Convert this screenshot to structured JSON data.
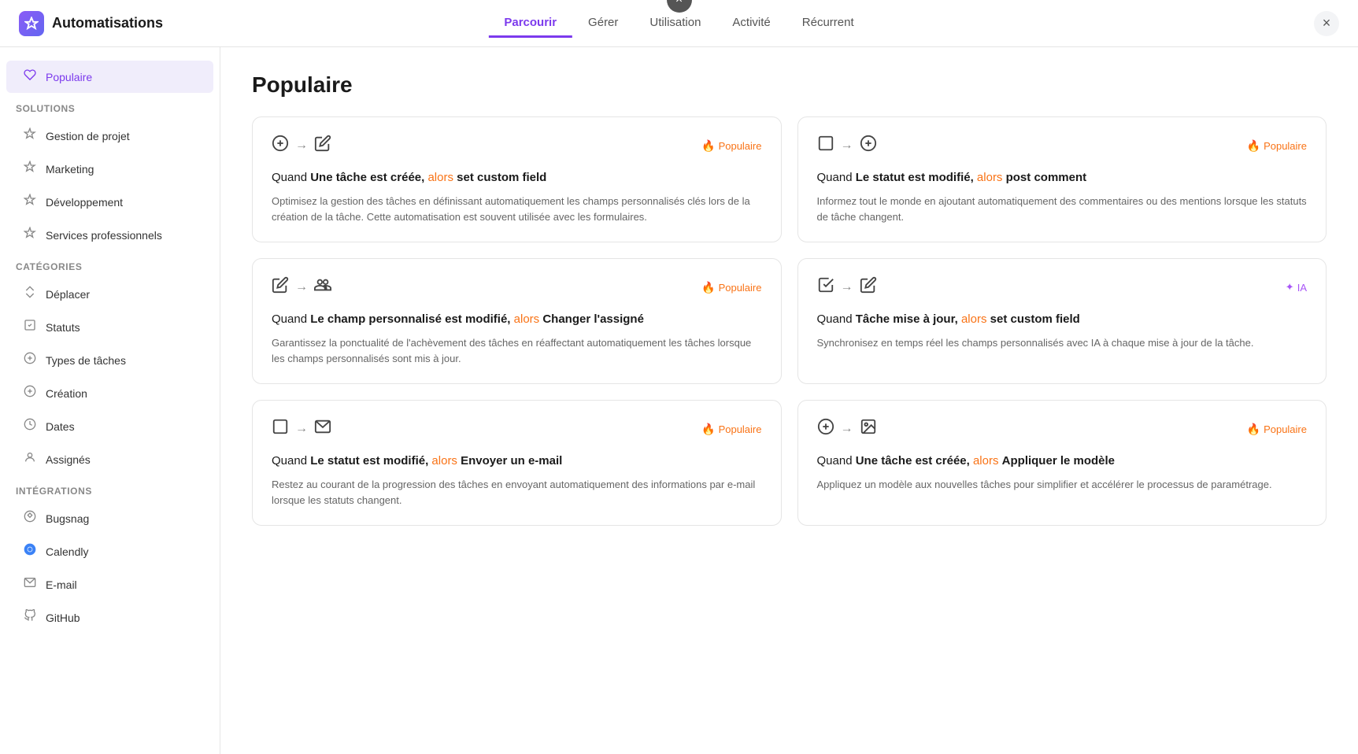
{
  "app": {
    "title": "Automatisations",
    "logo_symbol": "⚡"
  },
  "top_tabs": [
    {
      "id": "parcourir",
      "label": "Parcourir",
      "active": true
    },
    {
      "id": "gerer",
      "label": "Gérer",
      "active": false
    },
    {
      "id": "utilisation",
      "label": "Utilisation",
      "active": false
    },
    {
      "id": "activite",
      "label": "Activité",
      "active": false
    },
    {
      "id": "recurrent",
      "label": "Récurrent",
      "active": false
    }
  ],
  "close_label": "×",
  "sidebar": {
    "top_item": {
      "id": "populaire",
      "label": "Populaire",
      "icon": "♡",
      "active": true
    },
    "sections": [
      {
        "label": "Solutions",
        "items": [
          {
            "id": "gestion",
            "label": "Gestion de projet",
            "icon": "✦"
          },
          {
            "id": "marketing",
            "label": "Marketing",
            "icon": "✦"
          },
          {
            "id": "developpement",
            "label": "Développement",
            "icon": "✦"
          },
          {
            "id": "services",
            "label": "Services professionnels",
            "icon": "✦"
          }
        ]
      },
      {
        "label": "Catégories",
        "items": [
          {
            "id": "deplacer",
            "label": "Déplacer",
            "icon": "⤴"
          },
          {
            "id": "statuts",
            "label": "Statuts",
            "icon": "▣"
          },
          {
            "id": "types",
            "label": "Types de tâches",
            "icon": "⊕"
          },
          {
            "id": "creation",
            "label": "Création",
            "icon": "⊕"
          },
          {
            "id": "dates",
            "label": "Dates",
            "icon": "◷"
          },
          {
            "id": "assignes",
            "label": "Assignés",
            "icon": "⚇"
          }
        ]
      },
      {
        "label": "Intégrations",
        "items": [
          {
            "id": "bugsnag",
            "label": "Bugsnag",
            "icon": "⊹"
          },
          {
            "id": "calendly",
            "label": "Calendly",
            "icon": "●"
          },
          {
            "id": "email",
            "label": "E-mail",
            "icon": "✉"
          },
          {
            "id": "github",
            "label": "GitHub",
            "icon": "⊛"
          }
        ]
      }
    ]
  },
  "content": {
    "section_title": "Populaire",
    "cards": [
      {
        "id": "card1",
        "trigger_icon": "add-circle",
        "action_icon": "edit-square",
        "badge_type": "popular",
        "badge_label": "Populaire",
        "title_when": "Quand",
        "title_trigger": "Une tâche est créée,",
        "title_then": " alors",
        "title_action": " set custom field",
        "description": "Optimisez la gestion des tâches en définissant automatiquement les champs personnalisés clés lors de la création de la tâche. Cette automatisation est souvent utilisée avec les formulaires."
      },
      {
        "id": "card2",
        "trigger_icon": "status-square",
        "action_icon": "add-circle-outline",
        "badge_type": "popular",
        "badge_label": "Populaire",
        "title_when": "Quand",
        "title_trigger": "Le statut est modifié,",
        "title_then": " alors",
        "title_action": " post comment",
        "description": "Informez tout le monde en ajoutant automatiquement des commentaires ou des mentions lorsque les statuts de tâche changent."
      },
      {
        "id": "card3",
        "trigger_icon": "edit-square",
        "action_icon": "person-add",
        "badge_type": "popular",
        "badge_label": "Populaire",
        "title_when": "Quand",
        "title_trigger": "Le champ personnalisé est modifié,",
        "title_then": " alors",
        "title_action": " Changer l'assigné",
        "description": "Garantissez la ponctualité de l'achèvement des tâches en réaffectant automatiquement les tâches lorsque les champs personnalisés sont mis à jour."
      },
      {
        "id": "card4",
        "trigger_icon": "check-circle",
        "action_icon": "edit-square",
        "badge_type": "ai",
        "badge_label": "IA",
        "title_when": "Quand",
        "title_trigger": "Tâche mise à jour,",
        "title_then": " alors",
        "title_action": " set custom field",
        "description": "Synchronisez en temps réel les champs personnalisés avec IA à chaque mise à jour de la tâche."
      },
      {
        "id": "card5",
        "trigger_icon": "status-square",
        "action_icon": "email",
        "badge_type": "popular",
        "badge_label": "Populaire",
        "title_when": "Quand",
        "title_trigger": "Le statut est modifié,",
        "title_then": " alors",
        "title_action": " Envoyer un e-mail",
        "description": "Restez au courant de la progression des tâches en envoyant automatiquement des informations par e-mail lorsque les statuts changent."
      },
      {
        "id": "card6",
        "trigger_icon": "add-circle",
        "action_icon": "template",
        "badge_type": "popular",
        "badge_label": "Populaire",
        "title_when": "Quand",
        "title_trigger": "Une tâche est créée,",
        "title_then": " alors",
        "title_action": " Appliquer le modèle",
        "description": "Appliquez un modèle aux nouvelles tâches pour simplifier et accélérer le processus de paramétrage."
      }
    ]
  },
  "colors": {
    "accent": "#7c3aed",
    "popular_badge": "#f97316",
    "ai_badge": "#a855f7",
    "then_color": "#f97316"
  }
}
